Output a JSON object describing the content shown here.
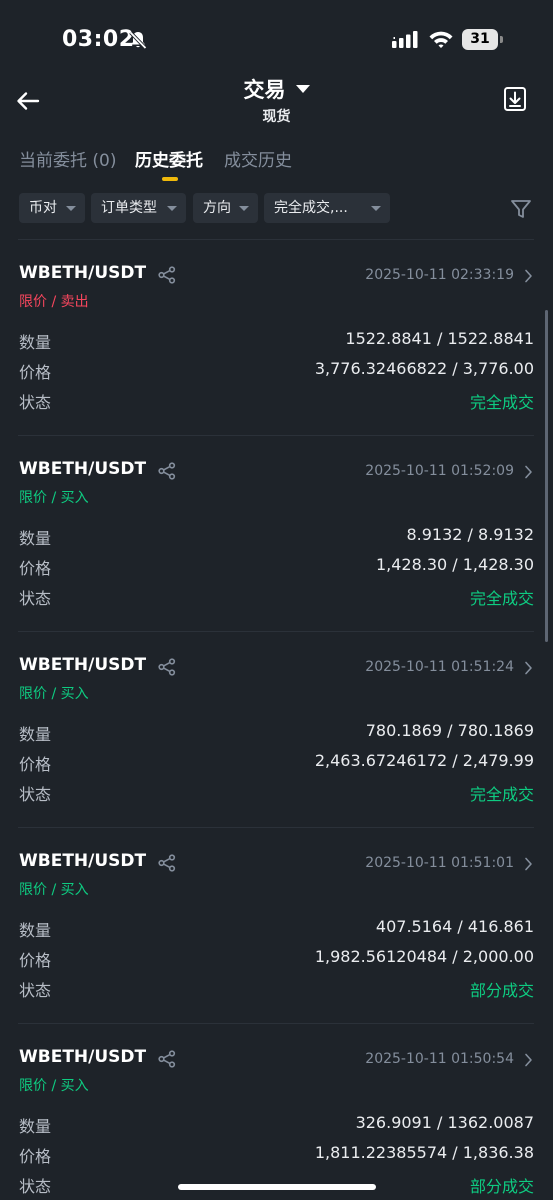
{
  "status_bar": {
    "time": "03:02",
    "battery": "31"
  },
  "header": {
    "title": "交易",
    "subtitle": "现货"
  },
  "tabs": [
    {
      "label": "当前委托 (0)",
      "active": false
    },
    {
      "label": "历史委托",
      "active": true
    },
    {
      "label": "成交历史",
      "active": false
    }
  ],
  "filters": [
    {
      "label": "币对"
    },
    {
      "label": "订单类型"
    },
    {
      "label": "方向"
    },
    {
      "label": "完全成交,..."
    }
  ],
  "labels": {
    "amount": "数量",
    "price": "价格",
    "status": "状态"
  },
  "orders": [
    {
      "pair": "WBETH/USDT",
      "date": "2025-10-11 02:33:19",
      "type": "限价 / 卖出",
      "side": "sell",
      "amount": "1522.8841 / 1522.8841",
      "price": "3,776.32466822 / 3,776.00",
      "status": "完全成交"
    },
    {
      "pair": "WBETH/USDT",
      "date": "2025-10-11 01:52:09",
      "type": "限价 / 买入",
      "side": "buy",
      "amount": "8.9132 / 8.9132",
      "price": "1,428.30 / 1,428.30",
      "status": "完全成交"
    },
    {
      "pair": "WBETH/USDT",
      "date": "2025-10-11 01:51:24",
      "type": "限价 / 买入",
      "side": "buy",
      "amount": "780.1869 / 780.1869",
      "price": "2,463.67246172 / 2,479.99",
      "status": "完全成交"
    },
    {
      "pair": "WBETH/USDT",
      "date": "2025-10-11 01:51:01",
      "type": "限价 / 买入",
      "side": "buy",
      "amount": "407.5164 / 416.861",
      "price": "1,982.56120484 / 2,000.00",
      "status": "部分成交"
    },
    {
      "pair": "WBETH/USDT",
      "date": "2025-10-11 01:50:54",
      "type": "限价 / 买入",
      "side": "buy",
      "amount": "326.9091 / 1362.0087",
      "price": "1,811.22385574 / 1,836.38",
      "status": "部分成交"
    }
  ],
  "colors": {
    "background": "#1e2329",
    "accent": "#f0b90b",
    "buy": "#0ecb81",
    "sell": "#f6465d"
  }
}
